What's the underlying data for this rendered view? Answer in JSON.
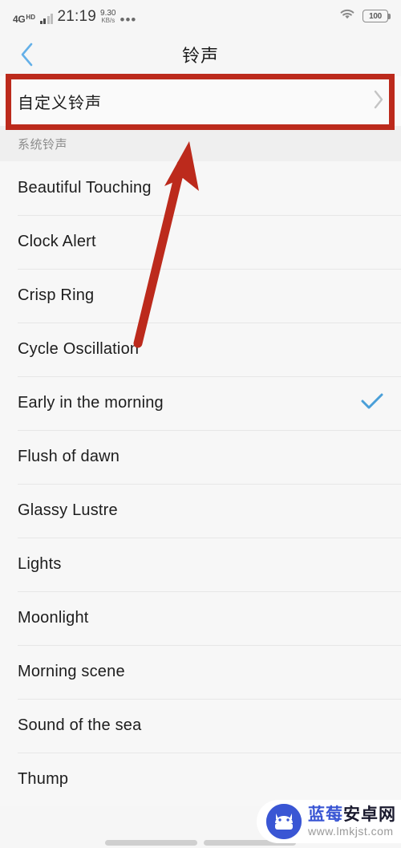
{
  "status_bar": {
    "network": "4G",
    "network_hd": "HD",
    "time": "21:19",
    "speed_value": "9.30",
    "speed_unit": "KB/s",
    "more_dots": "•••",
    "wifi_icon": "wifi-icon",
    "battery_level": "100"
  },
  "header": {
    "back_icon": "chevron-left-icon",
    "title": "铃声"
  },
  "custom_ringtone": {
    "label": "自定义铃声",
    "chevron_icon": "chevron-right-icon",
    "highlight_color": "#bc2a1c"
  },
  "section": {
    "title": "系统铃声"
  },
  "ringtones": [
    {
      "name": "Beautiful Touching",
      "selected": false
    },
    {
      "name": "Clock Alert",
      "selected": false
    },
    {
      "name": "Crisp Ring",
      "selected": false
    },
    {
      "name": "Cycle Oscillation",
      "selected": false
    },
    {
      "name": "Early in the morning",
      "selected": true
    },
    {
      "name": "Flush of dawn",
      "selected": false
    },
    {
      "name": "Glassy Lustre",
      "selected": false
    },
    {
      "name": "Lights",
      "selected": false
    },
    {
      "name": "Moonlight",
      "selected": false
    },
    {
      "name": "Morning scene",
      "selected": false
    },
    {
      "name": "Sound of the sea",
      "selected": false
    },
    {
      "name": "Thump",
      "selected": false
    }
  ],
  "annotation": {
    "arrow_color": "#bc2a1c",
    "arrow_name": "pointing-arrow"
  },
  "watermark": {
    "site_name_blue": "蓝莓",
    "site_name_dark": "安卓网",
    "url": "www.lmkjst.com",
    "logo_icon": "android-robot-icon"
  },
  "colors": {
    "accent_blue": "#4a9fd8",
    "back_blue": "#64b0e8",
    "page_bg": "#f7f7f7"
  }
}
